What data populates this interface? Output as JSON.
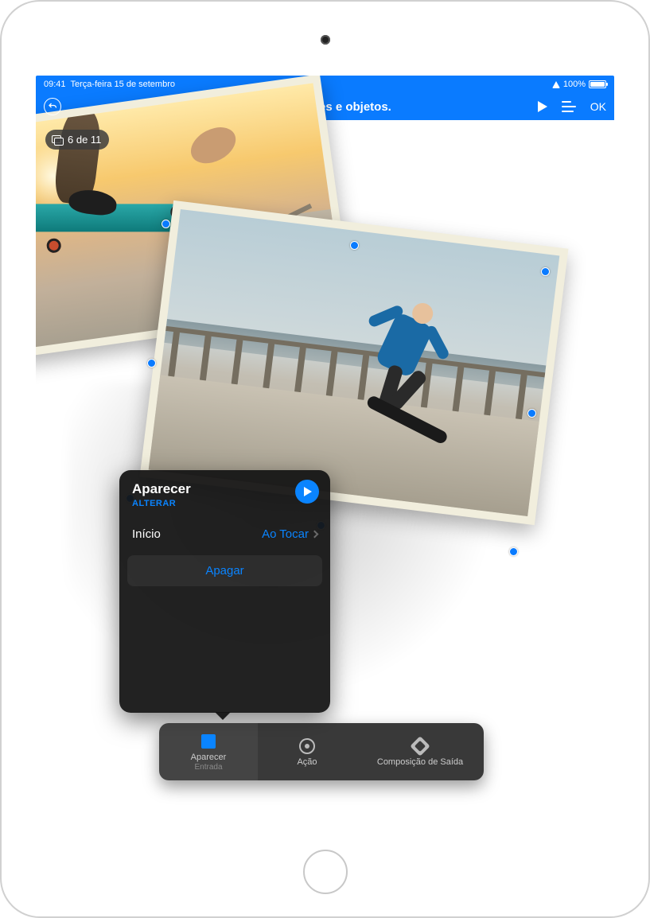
{
  "statusbar": {
    "time": "09:41",
    "date": "Terça-feira 15 de setembro",
    "battery_pct": "100%"
  },
  "navbar": {
    "title": "Anime slides e objetos.",
    "done": "OK"
  },
  "slide_counter": "6 de 11",
  "popover": {
    "effect_name": "Aparecer",
    "change_label": "ALTERAR",
    "start_label": "Início",
    "start_value": "Ao Tocar",
    "delete_label": "Apagar"
  },
  "tabs": {
    "build_in": {
      "label": "Aparecer",
      "sub": "Entrada"
    },
    "action": {
      "label": "Ação"
    },
    "build_out": {
      "label": "Composição de Saída"
    }
  }
}
